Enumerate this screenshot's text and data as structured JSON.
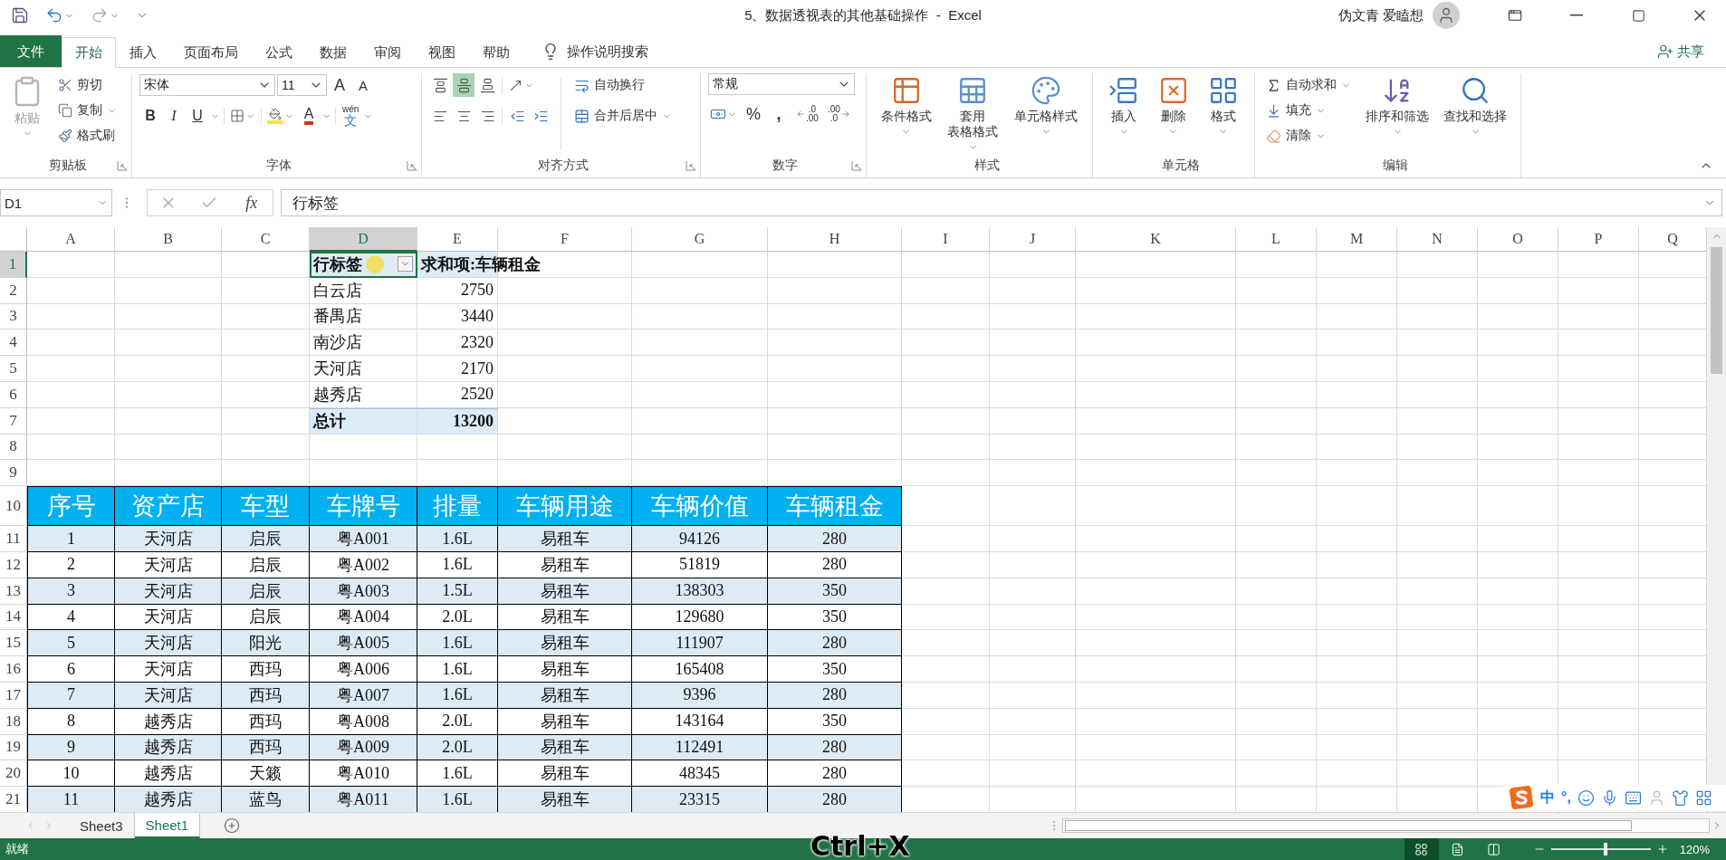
{
  "title_bar": {
    "title": "5、数据透视表的其他基础操作  -  Excel",
    "user": "伪文青 爱瞌想"
  },
  "menu_tabs": [
    {
      "label": "文件",
      "kind": "file",
      "selected": false
    },
    {
      "label": "开始",
      "kind": "tab",
      "selected": true
    },
    {
      "label": "插入",
      "kind": "tab",
      "selected": false
    },
    {
      "label": "页面布局",
      "kind": "tab",
      "selected": false
    },
    {
      "label": "公式",
      "kind": "tab",
      "selected": false
    },
    {
      "label": "数据",
      "kind": "tab",
      "selected": false
    },
    {
      "label": "审阅",
      "kind": "tab",
      "selected": false
    },
    {
      "label": "视图",
      "kind": "tab",
      "selected": false
    },
    {
      "label": "帮助",
      "kind": "tab",
      "selected": false
    }
  ],
  "tell_me": "操作说明搜索",
  "share": "共享",
  "ribbon": {
    "groups": [
      {
        "kind": "clipboard",
        "label": "剪贴板",
        "launcher": true,
        "paste": {
          "label": "粘贴",
          "disabled": true
        },
        "small": [
          {
            "label": "剪切",
            "dropdown": false
          },
          {
            "label": "复制",
            "dropdown": true
          },
          {
            "label": "格式刷",
            "dropdown": false
          }
        ]
      },
      {
        "kind": "font",
        "label": "字体",
        "launcher": true,
        "font_name": "宋体",
        "font_size": "11",
        "grow": "A",
        "shrink": "A",
        "bold": "B",
        "italic": "I",
        "underline": "U",
        "font_color": "A",
        "phonetic_top": "wén",
        "phonetic_bottom": "文"
      },
      {
        "kind": "alignment",
        "label": "对齐方式",
        "launcher": true,
        "vertical": [
          {
            "selected": false
          },
          {
            "selected": true
          },
          {
            "selected": false
          }
        ],
        "wrap": "自动换行",
        "merge": "合并后居中"
      },
      {
        "kind": "number",
        "label": "数字",
        "launcher": true,
        "format": "常规",
        "percent": "%",
        "comma": ",",
        "increase_decimal": [
          ".0",
          ".00"
        ],
        "decrease_decimal": [
          ".00",
          ".0"
        ]
      },
      {
        "kind": "styles",
        "label": "样式",
        "launcher": false,
        "buttons": [
          {
            "lines": [
              "条件格式"
            ]
          },
          {
            "lines": [
              "套用",
              "表格格式"
            ]
          },
          {
            "lines": [
              "单元格样式"
            ]
          }
        ]
      },
      {
        "kind": "cells",
        "label": "单元格",
        "launcher": false,
        "buttons": [
          {
            "lines": [
              "插入"
            ]
          },
          {
            "lines": [
              "删除"
            ]
          },
          {
            "lines": [
              "格式"
            ]
          }
        ]
      },
      {
        "kind": "editing",
        "label": "编辑",
        "launcher": false,
        "small": [
          {
            "label": "自动求和"
          },
          {
            "label": "填充"
          },
          {
            "label": "清除"
          }
        ],
        "buttons": [
          {
            "lines": [
              "排序和筛选"
            ]
          },
          {
            "lines": [
              "查找和选择"
            ]
          }
        ]
      }
    ]
  },
  "formula_bar": {
    "name_box": "D1",
    "function": "fx",
    "formula": "行标签"
  },
  "sheet": {
    "columns": [
      {
        "label": "A",
        "selected": false
      },
      {
        "label": "B",
        "selected": false
      },
      {
        "label": "C",
        "selected": false
      },
      {
        "label": "D",
        "selected": true
      },
      {
        "label": "E",
        "selected": false
      },
      {
        "label": "F",
        "selected": false
      },
      {
        "label": "G",
        "selected": false
      },
      {
        "label": "H",
        "selected": false
      },
      {
        "label": "I",
        "selected": false
      },
      {
        "label": "J",
        "selected": false
      },
      {
        "label": "K",
        "selected": false
      },
      {
        "label": "L",
        "selected": false
      },
      {
        "label": "M",
        "selected": false
      },
      {
        "label": "N",
        "selected": false
      },
      {
        "label": "O",
        "selected": false
      },
      {
        "label": "P",
        "selected": false
      },
      {
        "label": "Q",
        "selected": false
      }
    ],
    "rows": [
      {
        "number": "1",
        "selected": true,
        "kind": "pivot_header",
        "row_label": "行标签",
        "value_label": "求和项:车辆租金"
      },
      {
        "number": "2",
        "selected": false,
        "kind": "pivot_item",
        "label": "白云店",
        "value": "2750"
      },
      {
        "number": "3",
        "selected": false,
        "kind": "pivot_item",
        "label": "番禺店",
        "value": "3440"
      },
      {
        "number": "4",
        "selected": false,
        "kind": "pivot_item",
        "label": "南沙店",
        "value": "2320"
      },
      {
        "number": "5",
        "selected": false,
        "kind": "pivot_item",
        "label": "天河店",
        "value": "2170"
      },
      {
        "number": "6",
        "selected": false,
        "kind": "pivot_item",
        "label": "越秀店",
        "value": "2520"
      },
      {
        "number": "7",
        "selected": false,
        "kind": "pivot_total",
        "label": "总计",
        "value": "13200"
      },
      {
        "number": "8",
        "selected": false,
        "kind": "empty"
      },
      {
        "number": "9",
        "selected": false,
        "kind": "empty"
      },
      {
        "number": "10",
        "selected": false,
        "kind": "table_header",
        "cells": [
          "序号",
          "资产店",
          "车型",
          "车牌号",
          "排量",
          "车辆用途",
          "车辆价值",
          "车辆租金"
        ]
      },
      {
        "number": "11",
        "selected": false,
        "kind": "table_row",
        "cells": [
          "1",
          "天河店",
          "启辰",
          "粤A001",
          "1.6L",
          "易租车",
          "94126",
          "280"
        ]
      },
      {
        "number": "12",
        "selected": false,
        "kind": "table_row",
        "cells": [
          "2",
          "天河店",
          "启辰",
          "粤A002",
          "1.6L",
          "易租车",
          "51819",
          "280"
        ]
      },
      {
        "number": "13",
        "selected": false,
        "kind": "table_row",
        "cells": [
          "3",
          "天河店",
          "启辰",
          "粤A003",
          "1.5L",
          "易租车",
          "138303",
          "350"
        ]
      },
      {
        "number": "14",
        "selected": false,
        "kind": "table_row",
        "cells": [
          "4",
          "天河店",
          "启辰",
          "粤A004",
          "2.0L",
          "易租车",
          "129680",
          "350"
        ]
      },
      {
        "number": "15",
        "selected": false,
        "kind": "table_row",
        "cells": [
          "5",
          "天河店",
          "阳光",
          "粤A005",
          "1.6L",
          "易租车",
          "111907",
          "280"
        ]
      },
      {
        "number": "16",
        "selected": false,
        "kind": "table_row",
        "cells": [
          "6",
          "天河店",
          "西玛",
          "粤A006",
          "1.6L",
          "易租车",
          "165408",
          "350"
        ]
      },
      {
        "number": "17",
        "selected": false,
        "kind": "table_row",
        "cells": [
          "7",
          "天河店",
          "西玛",
          "粤A007",
          "1.6L",
          "易租车",
          "9396",
          "280"
        ]
      },
      {
        "number": "18",
        "selected": false,
        "kind": "table_row",
        "cells": [
          "8",
          "越秀店",
          "西玛",
          "粤A008",
          "2.0L",
          "易租车",
          "143164",
          "350"
        ]
      },
      {
        "number": "19",
        "selected": false,
        "kind": "table_row",
        "cells": [
          "9",
          "越秀店",
          "西玛",
          "粤A009",
          "2.0L",
          "易租车",
          "112491",
          "280"
        ]
      },
      {
        "number": "20",
        "selected": false,
        "kind": "table_row",
        "cells": [
          "10",
          "越秀店",
          "天籁",
          "粤A010",
          "1.6L",
          "易租车",
          "48345",
          "280"
        ]
      },
      {
        "number": "21",
        "selected": false,
        "kind": "table_row",
        "cells": [
          "11",
          "越秀店",
          "蓝鸟",
          "粤A011",
          "1.6L",
          "易租车",
          "23315",
          "280"
        ]
      }
    ]
  },
  "sheet_tabs": [
    {
      "label": "Sheet3",
      "selected": false
    },
    {
      "label": "Sheet1",
      "selected": true
    }
  ],
  "ime_bar": {
    "mode": "中",
    "punctuation": "°,"
  },
  "status_bar": {
    "status": "就绪",
    "views": [
      {
        "selected": true
      },
      {
        "selected": false
      },
      {
        "selected": false
      }
    ],
    "zoom": {
      "level": 0.55,
      "reading": "120%"
    }
  },
  "key_overlay": "Ctrl+X"
}
